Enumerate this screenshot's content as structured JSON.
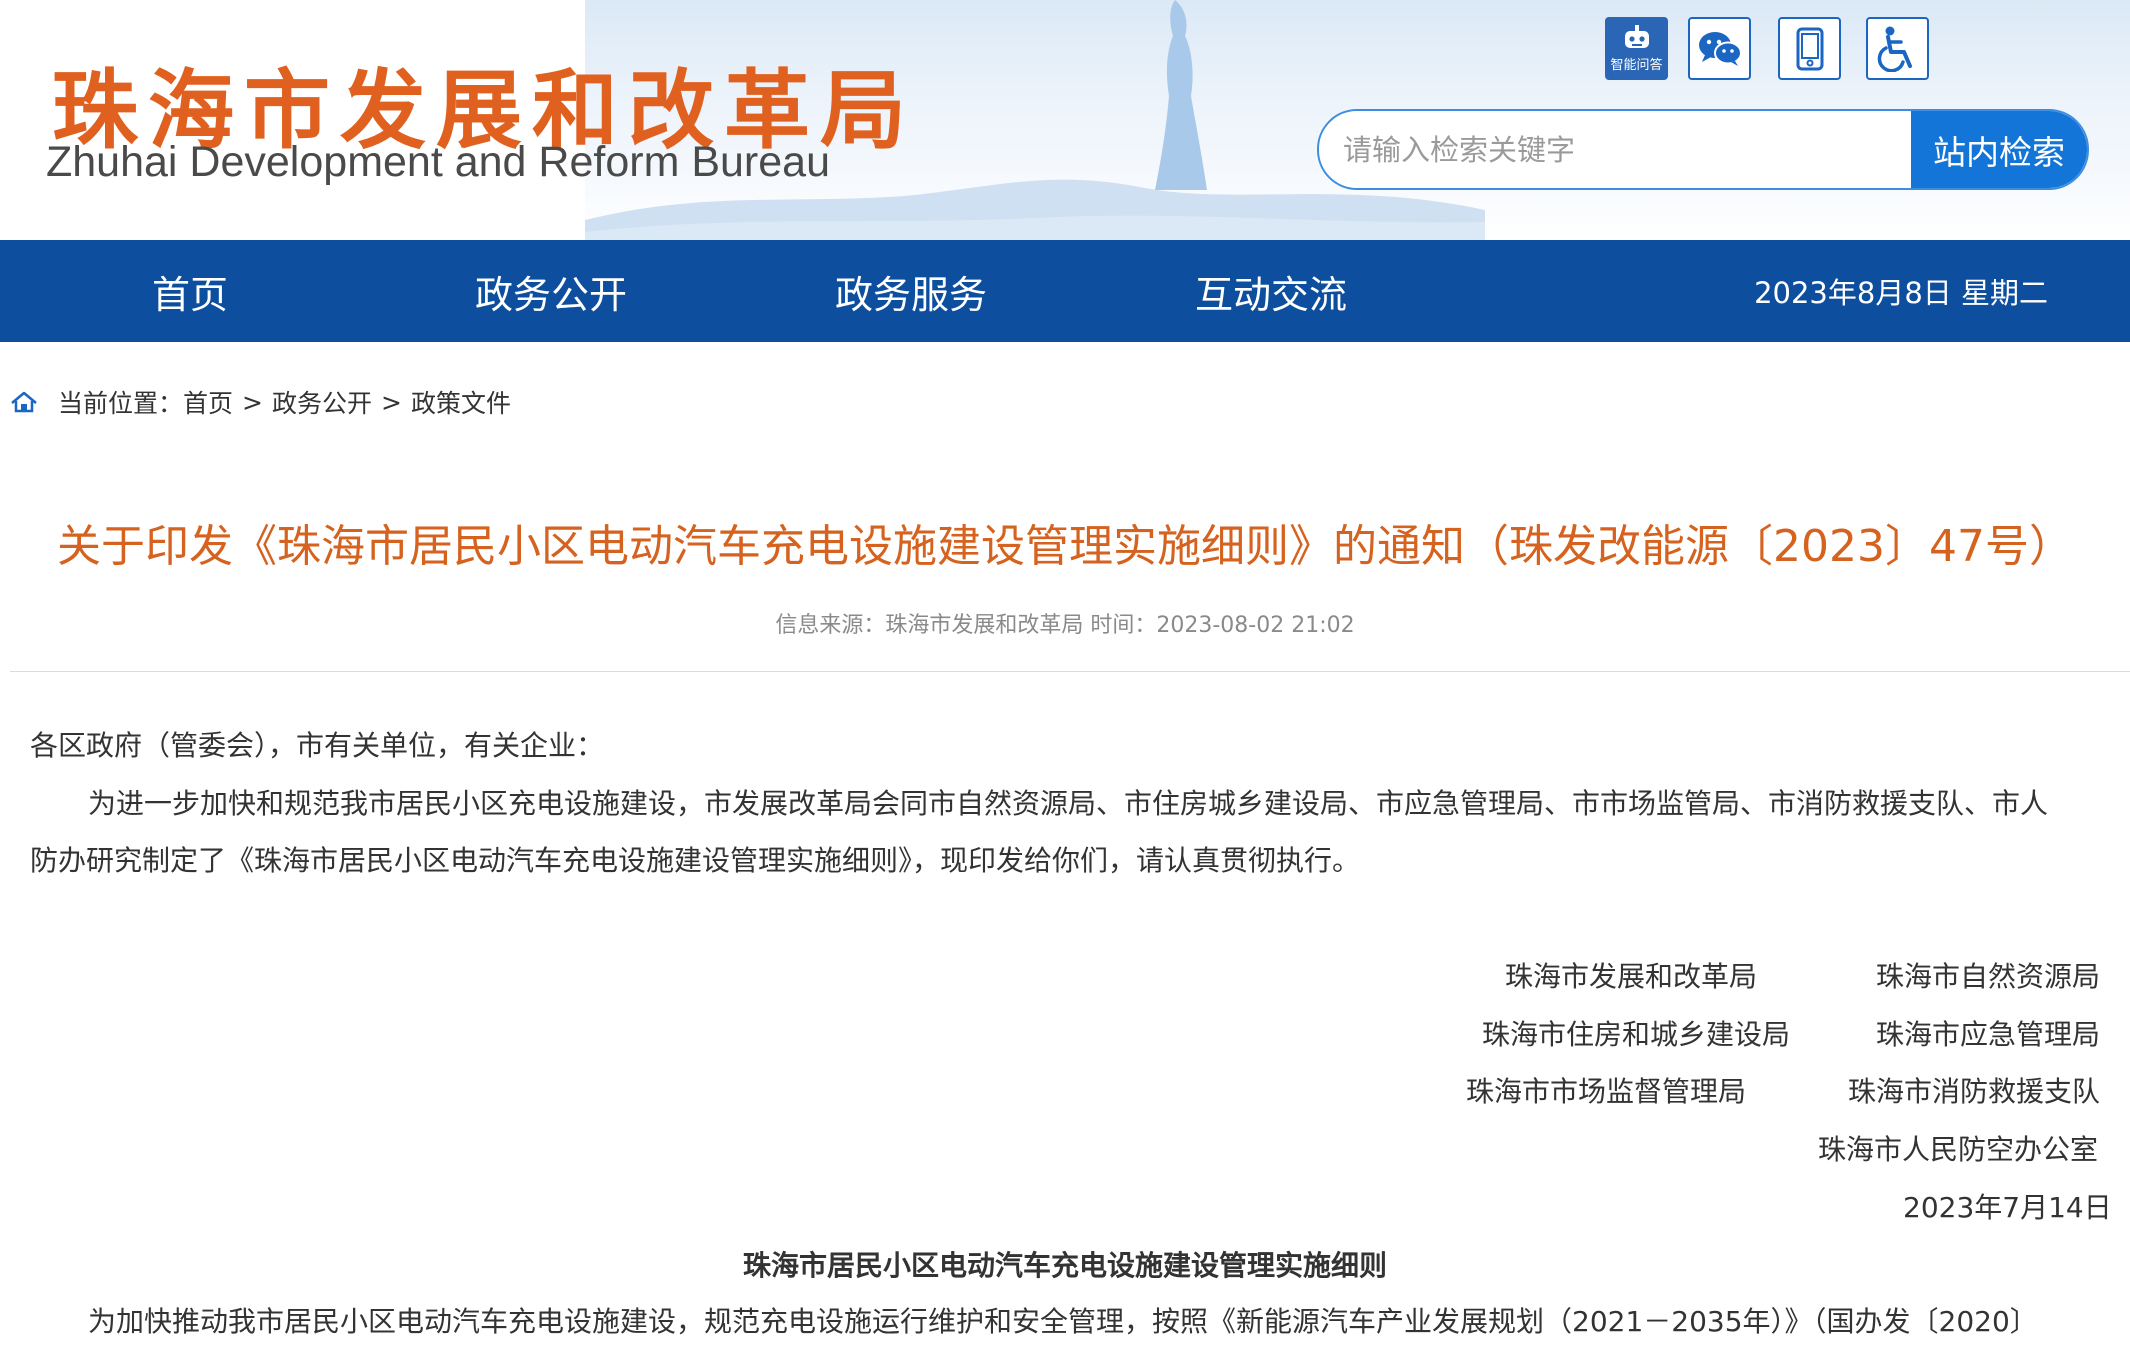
{
  "header": {
    "logo_cn": "珠海市发展和改革局",
    "logo_en": "Zhuhai Development and Reform Bureau",
    "tools": {
      "robot_label": "智能问答",
      "robot_icon": "robot-icon",
      "wechat_icon": "wechat-icon",
      "mobile_icon": "mobile-icon",
      "access_icon": "accessibility-icon"
    },
    "search": {
      "placeholder": "请输入检索关键字",
      "button_label": "站内检索"
    }
  },
  "nav": {
    "items": [
      {
        "label": "首页"
      },
      {
        "label": "政务公开"
      },
      {
        "label": "政务服务"
      },
      {
        "label": "互动交流"
      }
    ],
    "date": "2023年8月8日 星期二"
  },
  "breadcrumb": {
    "prefix": "当前位置：",
    "items": [
      "首页",
      "政务公开",
      "政策文件"
    ],
    "separator": ">"
  },
  "article": {
    "title": "关于印发《珠海市居民小区电动汽车充电设施建设管理实施细则》的通知（珠发改能源〔2023〕47号）",
    "meta": "信息来源：珠海市发展和改革局 时间：2023-08-02 21:02",
    "salutation": "各区政府（管委会），市有关单位，有关企业：",
    "para1_line1": "为进一步加快和规范我市居民小区充电设施建设，市发展改革局会同市自然资源局、市住房城乡建设局、市应急管理局、市市场监管局、市消防救援支队、市人",
    "para1_line2": "防办研究制定了《珠海市居民小区电动汽车充电设施建设管理实施细则》，现印发给你们，请认真贯彻执行。",
    "signatures": [
      "珠海市发展和改革局",
      "珠海市自然资源局",
      "珠海市住房和城乡建设局",
      "珠海市应急管理局",
      "珠海市市场监督管理局",
      "珠海市消防救援支队",
      "珠海市人民防空办公室"
    ],
    "date": "2023年7月14日",
    "subtitle": "珠海市居民小区电动汽车充电设施建设管理实施细则",
    "para2_line1": "为加快推动我市居民小区电动汽车充电设施建设，规范充电设施运行维护和安全管理，按照《新能源汽车产业发展规划（2021－2035年）》（国办发〔2020〕"
  },
  "colors": {
    "nav_bg": "#0d4f9e",
    "logo": "#e0611f",
    "title": "#d5621e",
    "search_button": "#1475d9"
  }
}
